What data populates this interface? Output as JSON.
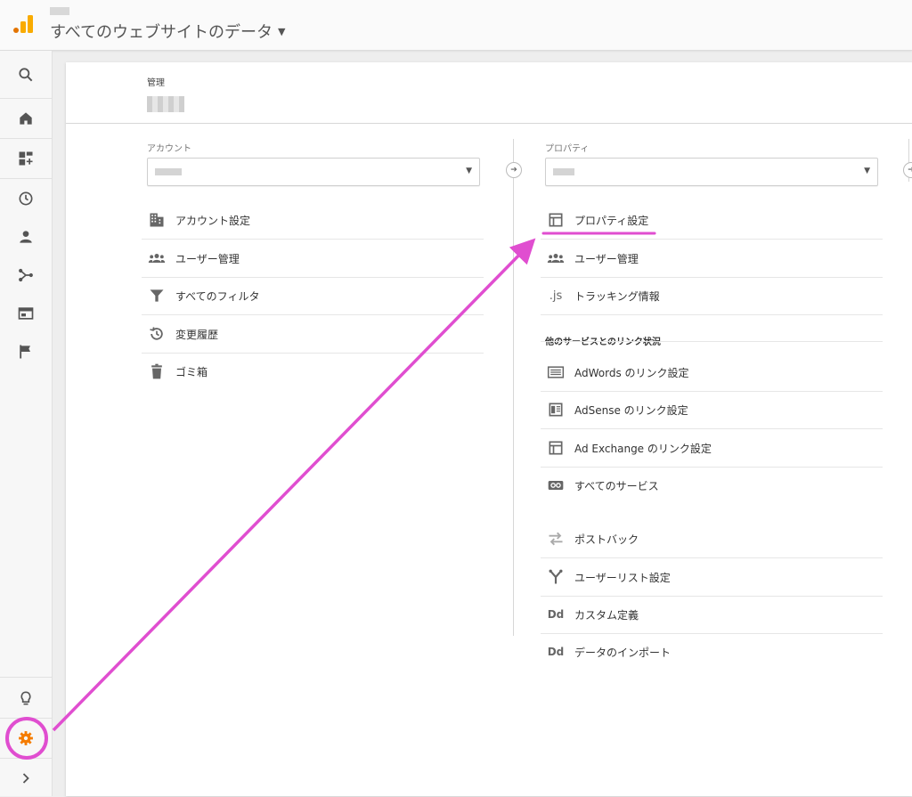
{
  "header": {
    "view_name": "すべてのウェブサイトのデータ"
  },
  "sidebar": {
    "items": [
      {
        "icon": "search-icon"
      },
      {
        "icon": "home-icon"
      },
      {
        "icon": "customization-icon"
      },
      {
        "icon": "realtime-clock-icon"
      },
      {
        "icon": "audience-person-icon"
      },
      {
        "icon": "acquisition-icon"
      },
      {
        "icon": "behavior-icon"
      },
      {
        "icon": "conversions-flag-icon"
      },
      {
        "icon": "discover-bulb-icon"
      },
      {
        "icon": "admin-gear-icon"
      },
      {
        "icon": "expand-chevron-icon"
      }
    ]
  },
  "admin": {
    "title": "管理"
  },
  "account": {
    "label": "アカウント",
    "items": [
      {
        "label": "アカウント設定",
        "icon": "building-icon"
      },
      {
        "label": "ユーザー管理",
        "icon": "people-icon"
      },
      {
        "label": "すべてのフィルタ",
        "icon": "filter-icon"
      },
      {
        "label": "変更履歴",
        "icon": "history-icon"
      },
      {
        "label": "ゴミ箱",
        "icon": "trash-icon"
      }
    ]
  },
  "property": {
    "label": "プロパティ",
    "items": [
      {
        "label": "プロパティ設定",
        "icon": "property-settings-icon"
      },
      {
        "label": "ユーザー管理",
        "icon": "people-icon"
      },
      {
        "label": "トラッキング情報",
        "icon": "js-icon",
        "icon_text": ".js"
      }
    ],
    "links_section_title": "他のサービスとのリンク状況",
    "link_items": [
      {
        "label": "AdWords のリンク設定",
        "icon": "adwords-icon"
      },
      {
        "label": "AdSense のリンク設定",
        "icon": "adsense-icon"
      },
      {
        "label": "Ad Exchange のリンク設定",
        "icon": "ad-exchange-icon"
      },
      {
        "label": "すべてのサービス",
        "icon": "link-icon"
      }
    ],
    "other_items": [
      {
        "label": "ポストバック",
        "icon": "postback-icon"
      },
      {
        "label": "ユーザーリスト設定",
        "icon": "fork-icon"
      },
      {
        "label": "カスタム定義",
        "icon": "dd-icon",
        "icon_text": "Dd"
      },
      {
        "label": "データのインポート",
        "icon": "dd-icon",
        "icon_text": "Dd"
      }
    ]
  },
  "colors": {
    "accent_orange": "#f57c00",
    "annotation_magenta": "#e04ed0",
    "icon_gray": "#666666"
  }
}
